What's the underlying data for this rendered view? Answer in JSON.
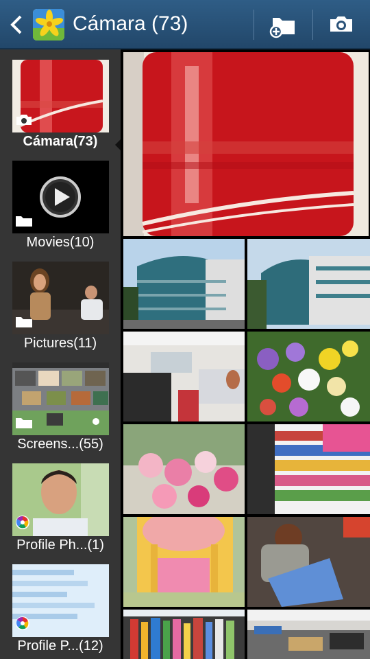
{
  "header": {
    "title": "Cámara (73)",
    "colors": {
      "bar": "#2f5d86",
      "text": "#ffffff"
    }
  },
  "albums": [
    {
      "label": "Cámara(73)",
      "badge": "camera-icon"
    },
    {
      "label": "Movies(10)",
      "badge": "folder-icon"
    },
    {
      "label": "Pictures(11)",
      "badge": "folder-icon"
    },
    {
      "label": "Screens...(55)",
      "badge": "folder-icon"
    },
    {
      "label": "Profile Ph...(1)",
      "badge": "picasa-icon"
    },
    {
      "label": "Profile P...(12)",
      "badge": "picasa-icon"
    }
  ]
}
